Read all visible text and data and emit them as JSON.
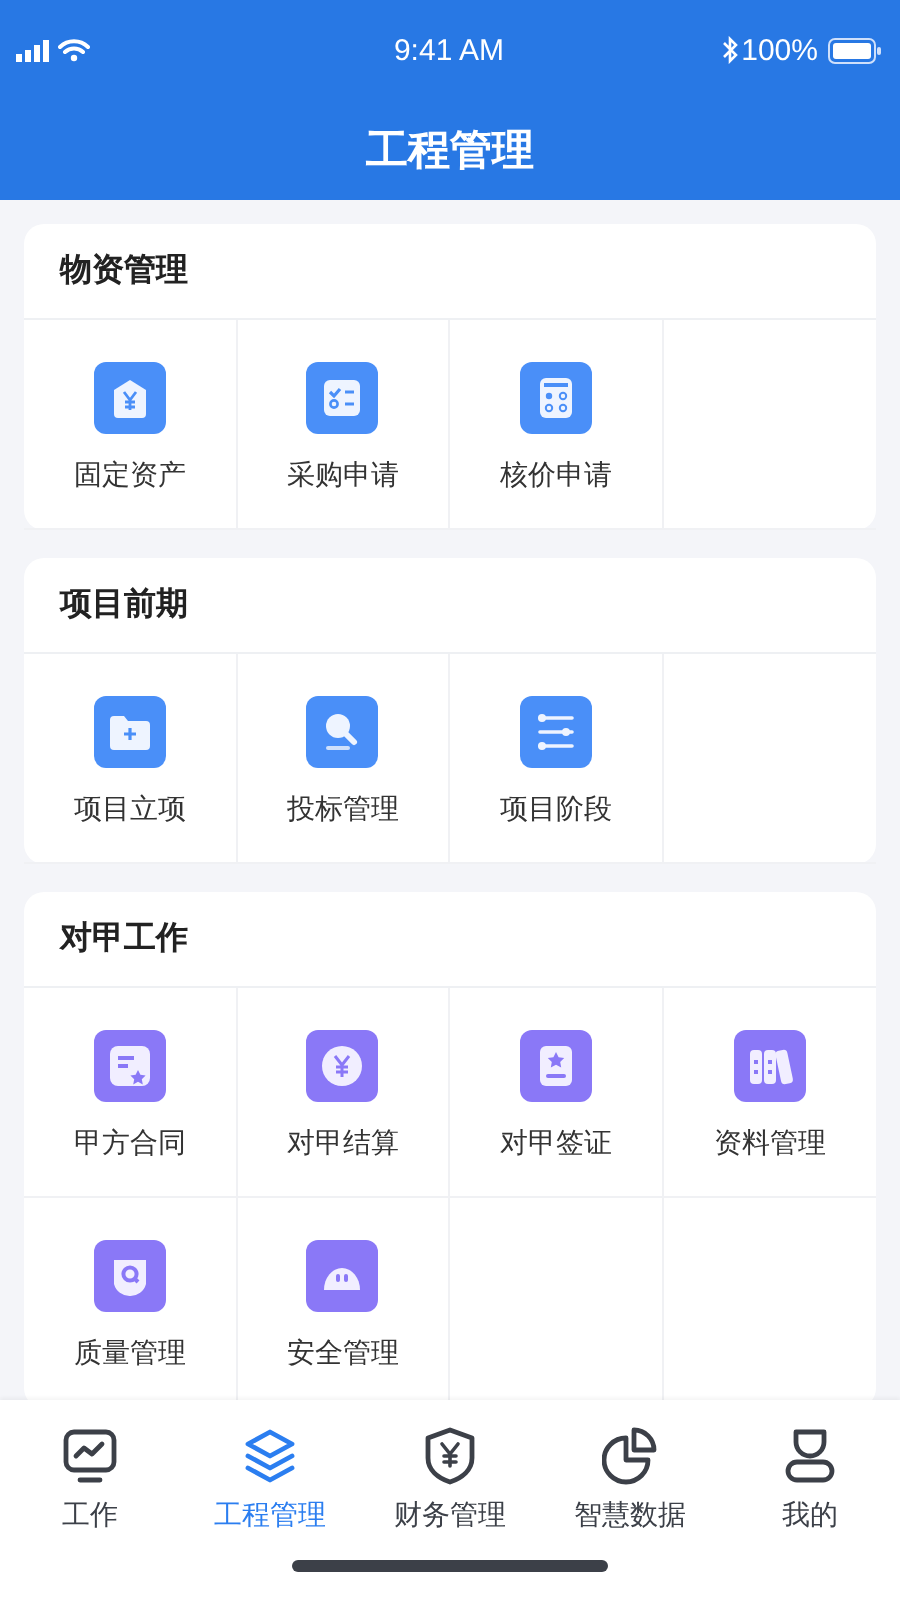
{
  "status_bar": {
    "time": "9:41 AM",
    "battery": "100%"
  },
  "header": {
    "title": "工程管理"
  },
  "sections": [
    {
      "title": "物资管理",
      "color": "#4a8ff8",
      "items": [
        {
          "label": "固定资产",
          "kind": "asset"
        },
        {
          "label": "采购申请",
          "kind": "checklist"
        },
        {
          "label": "核价申请",
          "kind": "calculator"
        }
      ]
    },
    {
      "title": "项目前期",
      "color": "#4a8ff8",
      "items": [
        {
          "label": "项目立项",
          "kind": "folder"
        },
        {
          "label": "投标管理",
          "kind": "gavel"
        },
        {
          "label": "项目阶段",
          "kind": "sliders"
        }
      ]
    },
    {
      "title": "对甲工作",
      "color": "#8a78f7",
      "items": [
        {
          "label": "甲方合同",
          "kind": "contract"
        },
        {
          "label": "对甲结算",
          "kind": "coin"
        },
        {
          "label": "对甲签证",
          "kind": "badge"
        },
        {
          "label": "资料管理",
          "kind": "binders"
        },
        {
          "label": "质量管理",
          "kind": "quality"
        },
        {
          "label": "安全管理",
          "kind": "helmet"
        }
      ]
    }
  ],
  "tab_bar": [
    {
      "label": "工作",
      "kind": "monitor",
      "selected": false
    },
    {
      "label": "工程管理",
      "kind": "layers",
      "selected": true
    },
    {
      "label": "财务管理",
      "kind": "shield",
      "selected": false
    },
    {
      "label": "智慧数据",
      "kind": "pie",
      "selected": false
    },
    {
      "label": "我的",
      "kind": "user",
      "selected": false
    }
  ]
}
